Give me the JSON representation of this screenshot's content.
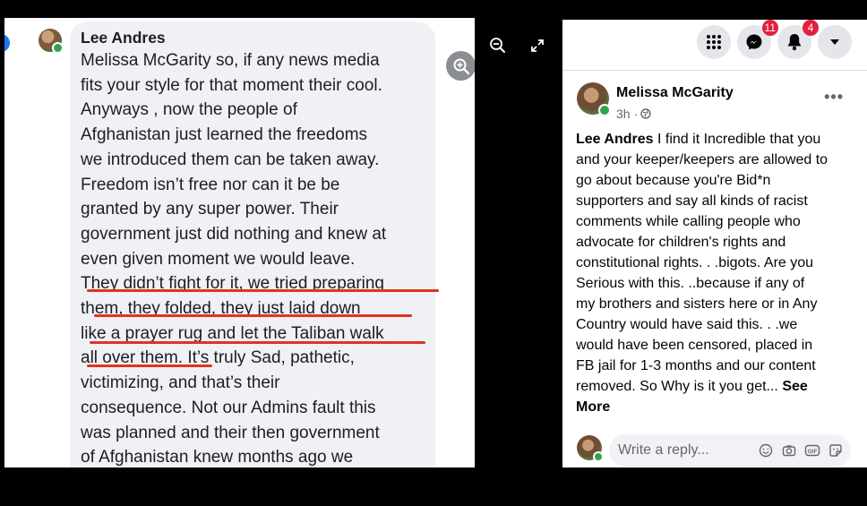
{
  "comment": {
    "author": "Lee Andres",
    "lines": [
      "Melissa McGarity so, if any news media",
      "fits your style for that moment their cool.",
      "Anyways , now the people of",
      "Afghanistan just learned the freedoms",
      "we introduced them can be taken away.",
      "Freedom isn’t free nor can it be be",
      "granted by any super power. Their",
      "government just did nothing and knew at",
      "even given moment we would leave.",
      "They didn’t fight for it, we tried preparing",
      "them, they folded, they just laid down",
      "like a prayer rug and let the Taliban walk",
      "all over them. It’s truly Sad, pathetic,",
      "victimizing, and that’s their",
      "consequence. Not our Admins fault this",
      "was planned and their then government",
      "of Afghanistan knew months ago we"
    ],
    "underline_color": "#e0341e"
  },
  "viewer": {
    "zoom_in_icon": "zoom-in-icon",
    "zoom_out_icon": "zoom-out-icon",
    "fullscreen_icon": "expand-icon"
  },
  "topbar": {
    "menu_icon": "grid-icon",
    "messenger_icon": "messenger-icon",
    "messenger_badge": "11",
    "notifications_icon": "bell-icon",
    "notifications_badge": "4",
    "account_icon": "caret-down-icon"
  },
  "post": {
    "author": "Melissa McGarity",
    "time": "3h ·",
    "more": "•••",
    "body_lines": [
      "I find it Incredible that you",
      "and your keeper/keepers are allowed to",
      "go about because you're Bid*n",
      "supporters and say all kinds of racist",
      "comments while calling people who",
      "advocate for children's rights and",
      "constitutional rights. . .bigots. Are you",
      "Serious with this. ..because if any of",
      "my brothers and sisters here or in Any",
      "Country would have said this. . .we",
      "would have been censored, placed in",
      "FB jail for 1-3 months and our content",
      "removed. So Why is it you get..."
    ],
    "mention": "Lee Andres",
    "see_more_1": "See",
    "see_more_2": "More"
  },
  "reply": {
    "placeholder": "Write a reply...",
    "icons": [
      "emoji-icon",
      "camera-icon",
      "gif-icon",
      "sticker-icon"
    ]
  },
  "colors": {
    "accent": "#1877f2",
    "badge": "#e41e3f",
    "online": "#31a24c",
    "bubble": "#eff1f4"
  }
}
